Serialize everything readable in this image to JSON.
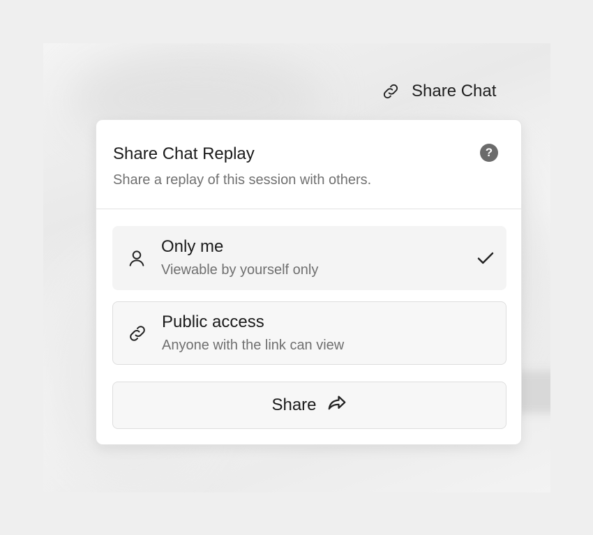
{
  "trigger": {
    "label": "Share Chat",
    "icon": "link-icon"
  },
  "popover": {
    "title": "Share Chat Replay",
    "subtitle": "Share a replay of this session with others.",
    "help_icon": "question-circle-icon",
    "help_glyph": "?"
  },
  "options": [
    {
      "label": "Only me",
      "description": "Viewable by yourself only",
      "icon": "user-icon",
      "selected": true
    },
    {
      "label": "Public access",
      "description": "Anyone with the link can view",
      "icon": "link-icon",
      "selected": false
    }
  ],
  "share_button": {
    "label": "Share",
    "icon": "share-arrow-icon"
  },
  "colors": {
    "background": "#efefef",
    "card": "#ffffff",
    "option_bg": "#f4f4f4",
    "muted_text": "#707070",
    "help_bg": "#6b6b6b"
  }
}
